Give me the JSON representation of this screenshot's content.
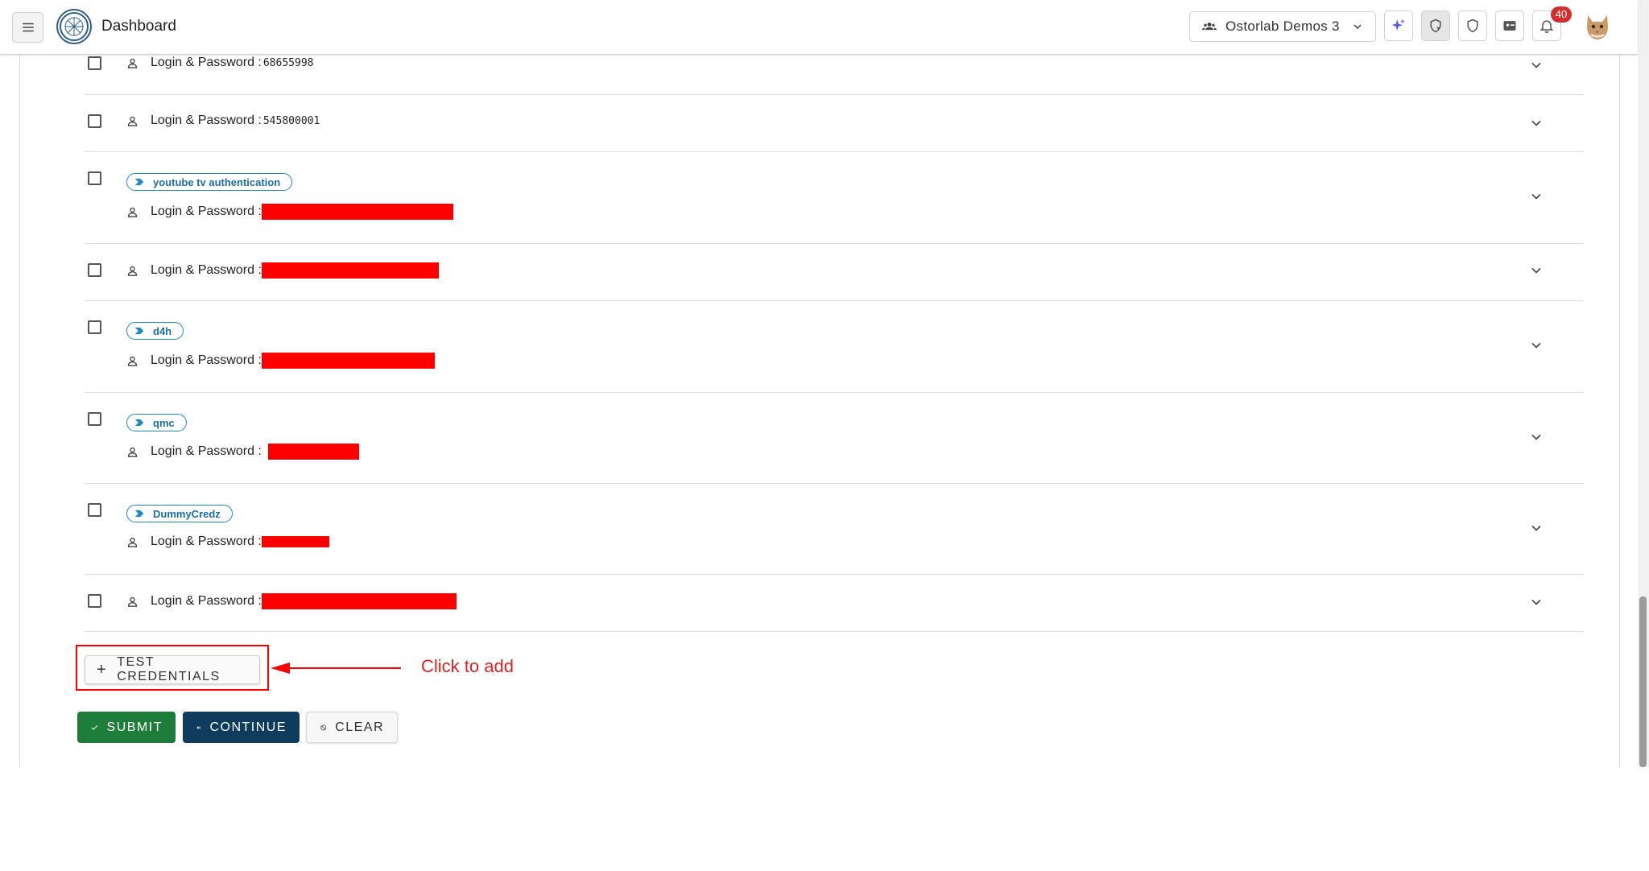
{
  "header": {
    "title": "Dashboard",
    "organization": "Ostorlab Demos 3",
    "notification_count": "40",
    "icons": [
      "menu-icon",
      "ostorlab-logo",
      "team-icon",
      "chevron-down-icon",
      "sparkle-ai-icon",
      "shield-sync-icon",
      "shield-icon",
      "id-card-icon",
      "bell-icon",
      "cat-avatar"
    ]
  },
  "credentials": {
    "label": "Login & Password :",
    "rows": [
      {
        "tag": "",
        "value": "68655998",
        "redacted": false
      },
      {
        "tag": "",
        "value": "545800001",
        "redacted": false
      },
      {
        "tag": "youtube tv authentication",
        "value": "",
        "redacted": true
      },
      {
        "tag": "",
        "value": "",
        "redacted": true
      },
      {
        "tag": "d4h",
        "value": "",
        "redacted": true
      },
      {
        "tag": "qmc",
        "value": "",
        "redacted": true
      },
      {
        "tag": "DummyCredz",
        "value": "",
        "redacted": true
      },
      {
        "tag": "",
        "value": "",
        "redacted": true
      }
    ]
  },
  "actions": {
    "add_label": "TEST CREDENTIALS",
    "annotation": "Click to add",
    "submit_label": "SUBMIT",
    "continue_label": "CONTINUE",
    "clear_label": "CLEAR"
  },
  "colors": {
    "accent_blue": "#1e88c7",
    "submit_green": "#1e7d3a",
    "continue_navy": "#0f3c5c",
    "annotation_red": "#ff0000",
    "badge_red": "#d32f2f"
  }
}
